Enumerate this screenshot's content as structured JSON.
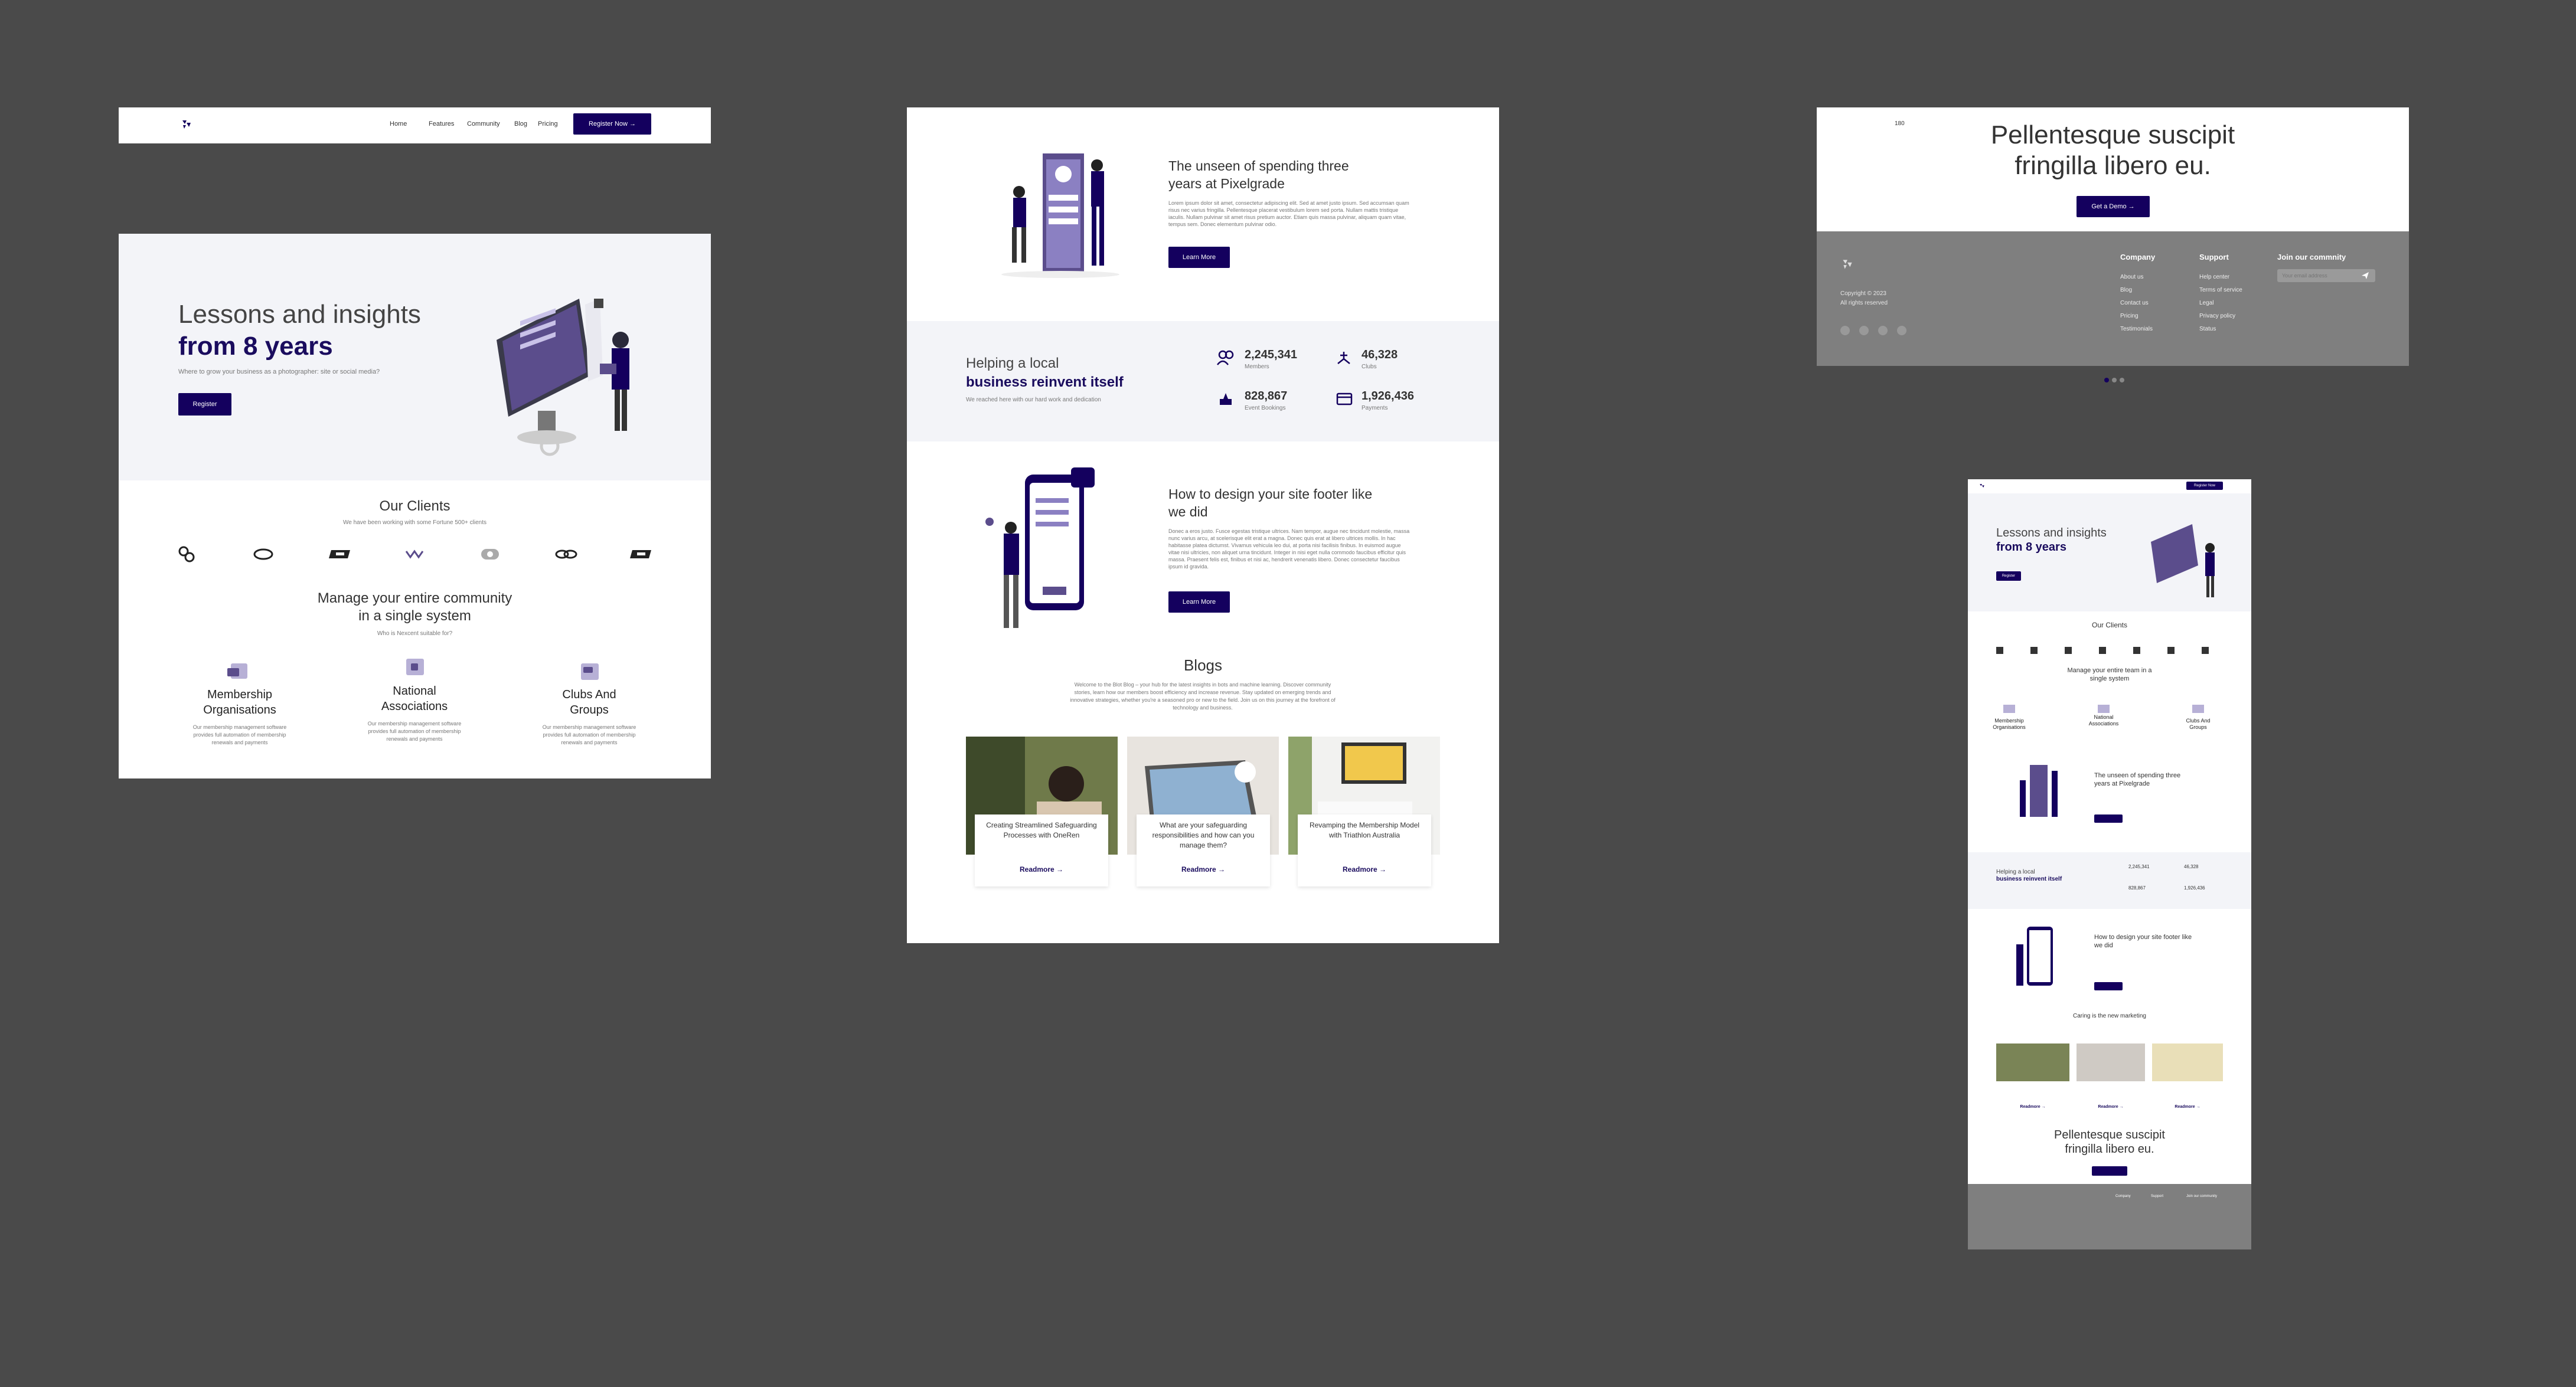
{
  "colors": {
    "background": "#4a4a4a",
    "brand": "#14005e",
    "hero_bg": "#f3f4f8",
    "footer_bg": "#7f7f7f"
  },
  "nav": {
    "links": [
      "Home",
      "Features",
      "Community",
      "Blog",
      "Pricing"
    ],
    "cta": "Register Now →"
  },
  "hero": {
    "title_line1": "Lessons and insights",
    "title_line2": "from 8 years",
    "subtitle": "Where to grow your business as a photographer: site or social media?",
    "button": "Register"
  },
  "clients": {
    "title": "Our Clients",
    "subtitle": "We have been working with some Fortune 500+ clients",
    "logos": [
      "client-logo-1",
      "client-logo-2",
      "client-logo-3",
      "client-logo-4",
      "client-logo-5",
      "client-logo-6",
      "client-logo-7"
    ]
  },
  "community": {
    "title_line1": "Manage your entire community",
    "title_line2": "in a single system",
    "subtitle": "Who is Nexcent suitable for?",
    "cards": [
      {
        "title_line1": "Membership",
        "title_line2": "Organisations",
        "text": "Our membership management software provides full automation of membership renewals and payments"
      },
      {
        "title_line1": "National",
        "title_line2": "Associations",
        "text": "Our membership management software provides full automation of membership renewals and payments"
      },
      {
        "title_line1": "Clubs And",
        "title_line2": "Groups",
        "text": "Our membership management software provides full automation of membership renewals and payments"
      }
    ]
  },
  "unseen": {
    "title_line1": "The unseen of spending three",
    "title_line2": "years at Pixelgrade",
    "body": "Lorem ipsum dolor sit amet, consectetur adipiscing elit. Sed at amet justo ipsum. Sed accumsan quam risus nec varius fringilla. Pellentesque placerat vestibulum lorem sed porta. Nullam mattis tristique iaculis. Nullam pulvinar sit amet risus pretium auctor. Etiam quis massa pulvinar, aliquam quam vitae, tempus sem. Donec elementum pulvinar odio.",
    "button": "Learn More"
  },
  "stats": {
    "title_line1": "Helping a local",
    "title_line2": "business reinvent itself",
    "subtitle": "We reached here with our hard work and dedication",
    "items": [
      {
        "value": "2,245,341",
        "label": "Members"
      },
      {
        "value": "46,328",
        "label": "Clubs"
      },
      {
        "value": "828,867",
        "label": "Event Bookings"
      },
      {
        "value": "1,926,436",
        "label": "Payments"
      }
    ]
  },
  "footer_design": {
    "title_line1": "How to design your site footer like",
    "title_line2": "we did",
    "body": "Donec a eros justo. Fusce egestas tristique ultrices. Nam tempor, augue nec tincidunt molestie, massa nunc varius arcu, at scelerisque elit erat a magna. Donec quis erat at libero ultrices mollis. In hac habitasse platea dictumst. Vivamus vehicula leo dui, at porta nisi facilisis finibus. In euismod augue vitae nisi ultricies, non aliquet urna tincidunt. Integer in nisi eget nulla commodo faucibus efficitur quis massa. Praesent felis est, finibus et nisi ac, hendrerit venenatis libero. Donec consectetur faucibus ipsum id gravida.",
    "button": "Learn More"
  },
  "blogs": {
    "title": "Blogs",
    "intro": "Welcome to the Blot Blog – your hub for the latest insights in bots and machine learning. Discover community stories, learn how our members boost efficiency and increase revenue. Stay updated on emerging trends and innovative strategies, whether you're a seasoned pro or new to the field. Join us on this journey at the forefront of technology and business.",
    "posts": [
      {
        "title": "Creating Streamlined Safeguarding Processes with OneRen",
        "link": "Readmore →"
      },
      {
        "title": "What are your safeguarding responsibilities and how can you manage them?",
        "link": "Readmore →"
      },
      {
        "title": "Revamping the Membership Model with Triathlon Australia",
        "link": "Readmore →"
      }
    ]
  },
  "cta": {
    "title_line1": "Pellentesque suscipit",
    "title_line2": "fringilla libero eu.",
    "button": "Get a Demo →",
    "small_label": "180"
  },
  "footer": {
    "copyright": "Copyright © 2023",
    "rights": "All rights reserved",
    "company_title": "Company",
    "company_links": [
      "About us",
      "Blog",
      "Contact us",
      "Pricing",
      "Testimonials"
    ],
    "support_title": "Support",
    "support_links": [
      "Help center",
      "Terms of service",
      "Legal",
      "Privacy policy",
      "Status"
    ],
    "join_title": "Join our commnity",
    "email_placeholder": "Your email address",
    "socials": [
      "instagram-icon",
      "dribbble-icon",
      "twitter-icon",
      "youtube-icon"
    ]
  },
  "mini": {
    "nav_button": "Register Now",
    "hero_title_line1": "Lessons and insights",
    "hero_title_line2": "from 8 years",
    "button": "Register",
    "clients_title": "Our Clients",
    "community_title_line1": "Manage your entire team in a",
    "community_title_line2": "single system",
    "cards": [
      {
        "l1": "Membership",
        "l2": "Organisations"
      },
      {
        "l1": "National",
        "l2": "Associations"
      },
      {
        "l1": "Clubs And",
        "l2": "Groups"
      }
    ],
    "unseen_line1": "The unseen of spending three",
    "unseen_line2": "years at Pixelgrade",
    "stats_line1": "Helping a local",
    "stats_line2": "business reinvent itself",
    "stats": [
      "2,245,341",
      "46,328",
      "828,867",
      "1,926,436"
    ],
    "design_line1": "How to design your site footer like",
    "design_line2": "we did",
    "blog_title": "Caring is the new marketing",
    "readmore": [
      "Readmore →",
      "Readmore →",
      "Readmore →"
    ],
    "cta_line1": "Pellentesque suscipit",
    "cta_line2": "fringilla libero eu.",
    "footer_titles": [
      "Company",
      "Support",
      "Join our community"
    ]
  }
}
